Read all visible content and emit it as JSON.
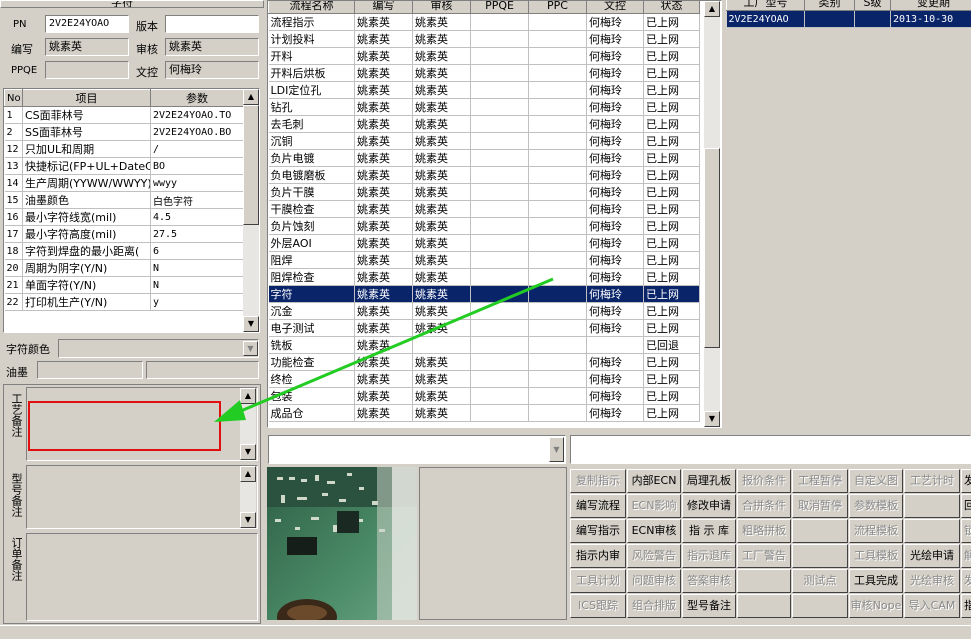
{
  "left_panel": {
    "header_label": "字符",
    "pn_label": "PN",
    "pn_value": "2V2E24YOAO",
    "version_label": "版本",
    "version_value": "",
    "writer_label": "编写",
    "writer_value": "姚素英",
    "reviewer_label": "审核",
    "reviewer_value": "姚素英",
    "ppqe_label": "PPQE",
    "ppqe_value": "",
    "doc_control_label": "文控",
    "doc_control_value": "何梅玲",
    "param_headers": [
      "No",
      "项目",
      "参数"
    ],
    "params": [
      {
        "no": "1",
        "item": "CS面菲林号",
        "value": "2V2E24YOAO.TO"
      },
      {
        "no": "2",
        "item": "SS面菲林号",
        "value": "2V2E24YOAO.BO"
      },
      {
        "no": "12",
        "item": "只加UL和周期",
        "value": "/"
      },
      {
        "no": "13",
        "item": "快捷标记(FP+UL+DateCo",
        "value": "BO"
      },
      {
        "no": "14",
        "item": "生产周期(YYWW/WWYY)",
        "value": "wwyy"
      },
      {
        "no": "15",
        "item": "油墨颜色",
        "value": "白色字符"
      },
      {
        "no": "16",
        "item": "最小字符线宽(mil)",
        "value": "4.5"
      },
      {
        "no": "17",
        "item": "最小字符高度(mil)",
        "value": "27.5"
      },
      {
        "no": "18",
        "item": "字符到焊盘的最小距离(",
        "value": "6"
      },
      {
        "no": "20",
        "item": "周期为阴字(Y/N)",
        "value": "N"
      },
      {
        "no": "21",
        "item": "单面字符(Y/N)",
        "value": "N"
      },
      {
        "no": "22",
        "item": "打印机生产(Y/N)",
        "value": "y"
      }
    ],
    "char_color_label": "字符颜色",
    "char_color_value": "",
    "ink_label": "油墨",
    "ink_value": "",
    "process_note_label": "工艺备注",
    "model_note_label": "型号备注",
    "order_note_label": "订单备注"
  },
  "process_grid": {
    "headers": [
      "流程名称",
      "编写",
      "审核",
      "PPQE",
      "PPC",
      "文控",
      "状态"
    ],
    "rows": [
      [
        "流程指示",
        "姚素英",
        "姚素英",
        "",
        "",
        "何梅玲",
        "已上网"
      ],
      [
        "计划投料",
        "姚素英",
        "姚素英",
        "",
        "",
        "何梅玲",
        "已上网"
      ],
      [
        "开料",
        "姚素英",
        "姚素英",
        "",
        "",
        "何梅玲",
        "已上网"
      ],
      [
        "开料后烘板",
        "姚素英",
        "姚素英",
        "",
        "",
        "何梅玲",
        "已上网"
      ],
      [
        "LDI定位孔",
        "姚素英",
        "姚素英",
        "",
        "",
        "何梅玲",
        "已上网"
      ],
      [
        "钻孔",
        "姚素英",
        "姚素英",
        "",
        "",
        "何梅玲",
        "已上网"
      ],
      [
        "去毛刺",
        "姚素英",
        "姚素英",
        "",
        "",
        "何梅玲",
        "已上网"
      ],
      [
        "沉铜",
        "姚素英",
        "姚素英",
        "",
        "",
        "何梅玲",
        "已上网"
      ],
      [
        "负片电镀",
        "姚素英",
        "姚素英",
        "",
        "",
        "何梅玲",
        "已上网"
      ],
      [
        "负电镀磨板",
        "姚素英",
        "姚素英",
        "",
        "",
        "何梅玲",
        "已上网"
      ],
      [
        "负片干膜",
        "姚素英",
        "姚素英",
        "",
        "",
        "何梅玲",
        "已上网"
      ],
      [
        "干膜检查",
        "姚素英",
        "姚素英",
        "",
        "",
        "何梅玲",
        "已上网"
      ],
      [
        "负片蚀刻",
        "姚素英",
        "姚素英",
        "",
        "",
        "何梅玲",
        "已上网"
      ],
      [
        "外层AOI",
        "姚素英",
        "姚素英",
        "",
        "",
        "何梅玲",
        "已上网"
      ],
      [
        "阻焊",
        "姚素英",
        "姚素英",
        "",
        "",
        "何梅玲",
        "已上网"
      ],
      [
        "阻焊检查",
        "姚素英",
        "姚素英",
        "",
        "",
        "何梅玲",
        "已上网"
      ],
      [
        "字符",
        "姚素英",
        "姚素英",
        "",
        "",
        "何梅玲",
        "已上网"
      ],
      [
        "沉金",
        "姚素英",
        "姚素英",
        "",
        "",
        "何梅玲",
        "已上网"
      ],
      [
        "电子测试",
        "姚素英",
        "姚素英",
        "",
        "",
        "何梅玲",
        "已上网"
      ],
      [
        "铣板",
        "姚素英",
        "",
        "",
        "",
        "",
        "已回退"
      ],
      [
        "功能检查",
        "姚素英",
        "姚素英",
        "",
        "",
        "何梅玲",
        "已上网"
      ],
      [
        "终检",
        "姚素英",
        "姚素英",
        "",
        "",
        "何梅玲",
        "已上网"
      ],
      [
        "包装",
        "姚素英",
        "姚素英",
        "",
        "",
        "何梅玲",
        "已上网"
      ],
      [
        "成品仓",
        "姚素英",
        "姚素英",
        "",
        "",
        "何梅玲",
        "已上网"
      ]
    ],
    "selected_index": 16
  },
  "right_grid": {
    "headers": [
      "工厂型号",
      "类别",
      "S级",
      "变更期"
    ],
    "rows": [
      [
        "2V2E24YOAO",
        "",
        "",
        "2013-10-30"
      ]
    ]
  },
  "buttons": [
    [
      {
        "label": "复制指示",
        "enabled": false
      },
      {
        "label": "内部ECN",
        "enabled": true
      },
      {
        "label": "局理孔板",
        "enabled": true
      },
      {
        "label": "报价条件",
        "enabled": false
      },
      {
        "label": "工程暂停",
        "enabled": false
      },
      {
        "label": "自定义图",
        "enabled": false
      },
      {
        "label": "工艺计时",
        "enabled": false
      },
      {
        "label": "发",
        "enabled": true
      }
    ],
    [
      {
        "label": "编写流程",
        "enabled": true
      },
      {
        "label": "ECN影响",
        "enabled": false
      },
      {
        "label": "修改申请",
        "enabled": true
      },
      {
        "label": "合拼条件",
        "enabled": false
      },
      {
        "label": "取消暂停",
        "enabled": false
      },
      {
        "label": "参数模板",
        "enabled": false
      },
      {
        "label": "",
        "enabled": false
      },
      {
        "label": "回",
        "enabled": true
      }
    ],
    [
      {
        "label": "编写指示",
        "enabled": true
      },
      {
        "label": "ECN审核",
        "enabled": true
      },
      {
        "label": "指 示 库",
        "enabled": true
      },
      {
        "label": "粗略拼板",
        "enabled": false
      },
      {
        "label": "",
        "enabled": false
      },
      {
        "label": "流程模板",
        "enabled": false
      },
      {
        "label": "",
        "enabled": false
      },
      {
        "label": "锁",
        "enabled": false
      }
    ],
    [
      {
        "label": "指示内审",
        "enabled": true
      },
      {
        "label": "风险警告",
        "enabled": false
      },
      {
        "label": "指示退库",
        "enabled": false
      },
      {
        "label": "工厂警告",
        "enabled": false
      },
      {
        "label": "",
        "enabled": false
      },
      {
        "label": "工具模板",
        "enabled": false
      },
      {
        "label": "光绘申请",
        "enabled": true
      },
      {
        "label": "解",
        "enabled": false
      }
    ],
    [
      {
        "label": "工具计划",
        "enabled": false
      },
      {
        "label": "问题审核",
        "enabled": false
      },
      {
        "label": "答案审核",
        "enabled": false
      },
      {
        "label": "",
        "enabled": false
      },
      {
        "label": "测试点",
        "enabled": false
      },
      {
        "label": "工具完成",
        "enabled": true
      },
      {
        "label": "光绘审核",
        "enabled": false
      },
      {
        "label": "发",
        "enabled": false
      }
    ],
    [
      {
        "label": "ICS跟踪",
        "enabled": false
      },
      {
        "label": "组合排版",
        "enabled": false
      },
      {
        "label": "型号备注",
        "enabled": true
      },
      {
        "label": "",
        "enabled": false
      },
      {
        "label": "",
        "enabled": false
      },
      {
        "label": "审核Nope",
        "enabled": false
      },
      {
        "label": "导入CAM",
        "enabled": false
      },
      {
        "label": "指",
        "enabled": true
      }
    ]
  ],
  "colors": {
    "window_bg": "#d4d0c8",
    "selection": "#0a246a",
    "highlight_box": "#e01010",
    "arrow": "#22cc22"
  },
  "icons": {
    "scroll_up": "▲",
    "scroll_down": "▼"
  }
}
